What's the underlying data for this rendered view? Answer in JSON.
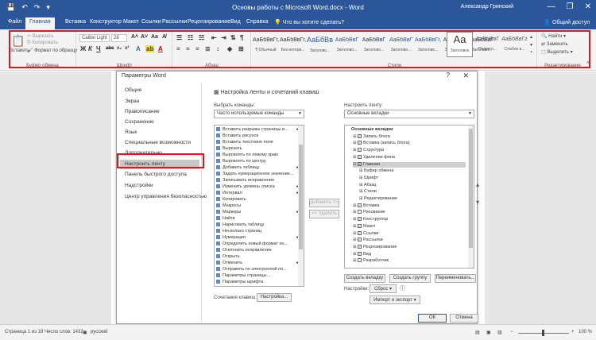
{
  "titlebar": {
    "title": "Основы работы с Microsoft Word.docx - Word",
    "user": "Александр Гринский",
    "qat": [
      "💾",
      "↶",
      "↷",
      "▾"
    ],
    "winbtns": [
      "—",
      "❐",
      "✕"
    ]
  },
  "tabs": [
    {
      "label": "Файл"
    },
    {
      "label": "Главная"
    },
    {
      "label": "Вставка"
    },
    {
      "label": "Конструктор"
    },
    {
      "label": "Макет"
    },
    {
      "label": "Ссылки"
    },
    {
      "label": "Рассылки"
    },
    {
      "label": "Рецензирование"
    },
    {
      "label": "Вид"
    },
    {
      "label": "Справка"
    },
    {
      "label": "Что вы хотите сделать?"
    }
  ],
  "share_label": "Общий доступ",
  "ribbon": {
    "clipboard": {
      "paste": "Вставить",
      "cut": "Вырезать",
      "copy": "Копировать",
      "format": "Формат по образцу",
      "group": "Буфер обмена"
    },
    "font": {
      "name": "Calibri Light",
      "size": "28",
      "group": "Шрифт",
      "btns": [
        "Ж",
        "К",
        "Ч",
        "abc",
        "x₂",
        "x²",
        "A",
        "A"
      ]
    },
    "paragraph": {
      "group": "Абзац"
    },
    "styles": {
      "group": "Стили",
      "items": [
        {
          "preview": "АаБбВвГг,",
          "name": "¶ Обычный"
        },
        {
          "preview": "АаБбВвГг,",
          "name": "Без интерв..."
        },
        {
          "preview": "АаБбВв",
          "name": "Заголово..."
        },
        {
          "preview": "АаБбВвГ",
          "name": "Заголово..."
        },
        {
          "preview": "АаБбВвГ",
          "name": "Заголово..."
        },
        {
          "preview": "АаБбВвГ",
          "name": "Заголово..."
        },
        {
          "preview": "АаБбВвГг,",
          "name": "Заголово..."
        },
        {
          "preview": "АаБбВвГ",
          "name": "Заголово..."
        },
        {
          "preview": "АаБбВвГ",
          "name": "Заголово..."
        },
        {
          "preview": "Аа",
          "name": "Заголовок"
        },
        {
          "preview": "АаБбВвГ",
          "name": "Подзаго..."
        },
        {
          "preview": "АаБбВвГг,",
          "name": "Слабое в..."
        }
      ]
    },
    "editing": {
      "find": "Найти",
      "replace": "Заменить",
      "select": "Выделить",
      "group": "Редактирование"
    }
  },
  "dialog": {
    "title": "Параметры Word",
    "help": "?",
    "close": "✕",
    "nav": [
      {
        "label": "Общие"
      },
      {
        "label": "Экран"
      },
      {
        "label": "Правописание"
      },
      {
        "label": "Сохранение"
      },
      {
        "label": "Язык"
      },
      {
        "label": "Специальные возможности"
      },
      {
        "label": "Дополнительно"
      },
      {
        "label": "Настроить ленту"
      },
      {
        "label": "Панель быстрого доступа"
      },
      {
        "label": "Надстройки"
      },
      {
        "label": "Центр управления безопасностью"
      }
    ],
    "section_title": "Настройка ленты и сочетаний клавиш",
    "choose_label": "Выбрать команды:",
    "choose_value": "Часто используемые команды",
    "customize_label": "Настроить ленту:",
    "customize_value": "Основные вкладки",
    "commands": [
      {
        "label": "Вставить разрывы страницы и...",
        "sub": "▸"
      },
      {
        "label": "Вставить рисунок",
        "sub": ""
      },
      {
        "label": "Вставить текстовое поле",
        "sub": ""
      },
      {
        "label": "Вырезать",
        "sub": ""
      },
      {
        "label": "Выровнять по левому краю",
        "sub": ""
      },
      {
        "label": "Выровнять по центру",
        "sub": ""
      },
      {
        "label": "Добавить таблицу",
        "sub": "▸"
      },
      {
        "label": "Задать нумерационное значение...",
        "sub": ""
      },
      {
        "label": "Записывать исправления",
        "sub": ""
      },
      {
        "label": "Изменить уровень списка",
        "sub": "▸"
      },
      {
        "label": "Интервал",
        "sub": "▸"
      },
      {
        "label": "Копировать",
        "sub": ""
      },
      {
        "label": "Макросы",
        "sub": ""
      },
      {
        "label": "Маркеры",
        "sub": "▸"
      },
      {
        "label": "Найти",
        "sub": ""
      },
      {
        "label": "Нарисовать таблицу",
        "sub": ""
      },
      {
        "label": "Несколько страниц",
        "sub": ""
      },
      {
        "label": "Нумерация",
        "sub": "▸"
      },
      {
        "label": "Определить новый формат но...",
        "sub": ""
      },
      {
        "label": "Отклонить исправление",
        "sub": ""
      },
      {
        "label": "Открыть",
        "sub": ""
      },
      {
        "label": "Отменить",
        "sub": "▸"
      },
      {
        "label": "Отправить по электронной по...",
        "sub": ""
      },
      {
        "label": "Параметры страницы...",
        "sub": ""
      },
      {
        "label": "Параметры шрифта",
        "sub": ""
      }
    ],
    "add_button": "Добавить >>",
    "remove_button": "<< Удалить",
    "tree": [
      {
        "label": "Основные вкладки",
        "level": 0,
        "exp": "",
        "cb": false,
        "bold": true
      },
      {
        "label": "Запись блога",
        "level": 1,
        "exp": "⊞",
        "cb": true
      },
      {
        "label": "Вставка (запись блога)",
        "level": 1,
        "exp": "⊞",
        "cb": true
      },
      {
        "label": "Структура",
        "level": 1,
        "exp": "⊞",
        "cb": true
      },
      {
        "label": "Удаление фона",
        "level": 1,
        "exp": "⊞",
        "cb": true
      },
      {
        "label": "Главная",
        "level": 1,
        "exp": "⊟",
        "cb": true,
        "hl": true
      },
      {
        "label": "Буфер обмена",
        "level": 2,
        "exp": "⊞",
        "cb": false
      },
      {
        "label": "Шрифт",
        "level": 2,
        "exp": "⊞",
        "cb": false
      },
      {
        "label": "Абзац",
        "level": 2,
        "exp": "⊞",
        "cb": false
      },
      {
        "label": "Стили",
        "level": 2,
        "exp": "⊞",
        "cb": false
      },
      {
        "label": "Редактирование",
        "level": 2,
        "exp": "⊞",
        "cb": false
      },
      {
        "label": "Вставка",
        "level": 1,
        "exp": "⊞",
        "cb": true
      },
      {
        "label": "Рисование",
        "level": 1,
        "exp": "⊞",
        "cb": false
      },
      {
        "label": "Конструктор",
        "level": 1,
        "exp": "⊞",
        "cb": true
      },
      {
        "label": "Макет",
        "level": 1,
        "exp": "⊞",
        "cb": true
      },
      {
        "label": "Ссылки",
        "level": 1,
        "exp": "⊞",
        "cb": true
      },
      {
        "label": "Рассылки",
        "level": 1,
        "exp": "⊞",
        "cb": true
      },
      {
        "label": "Рецензирование",
        "level": 1,
        "exp": "⊞",
        "cb": true
      },
      {
        "label": "Вид",
        "level": 1,
        "exp": "⊞",
        "cb": true
      },
      {
        "label": "Разработчик",
        "level": 1,
        "exp": "⊞",
        "cb": false
      }
    ],
    "new_tab": "Создать вкладку",
    "new_group": "Создать группу",
    "rename": "Переименовать...",
    "settings_label": "Настройки:",
    "reset": "Сброс ▾",
    "import_export": "Импорт и экспорт ▾",
    "shortcuts_label": "Сочетания клавиш:",
    "shortcuts_btn": "Настройка...",
    "ok": "ОК",
    "cancel": "Отмена"
  },
  "status": {
    "page": "Страница 1 из 18",
    "words": "Число слов: 1432",
    "lang": "русский",
    "zoom": "100 %"
  }
}
